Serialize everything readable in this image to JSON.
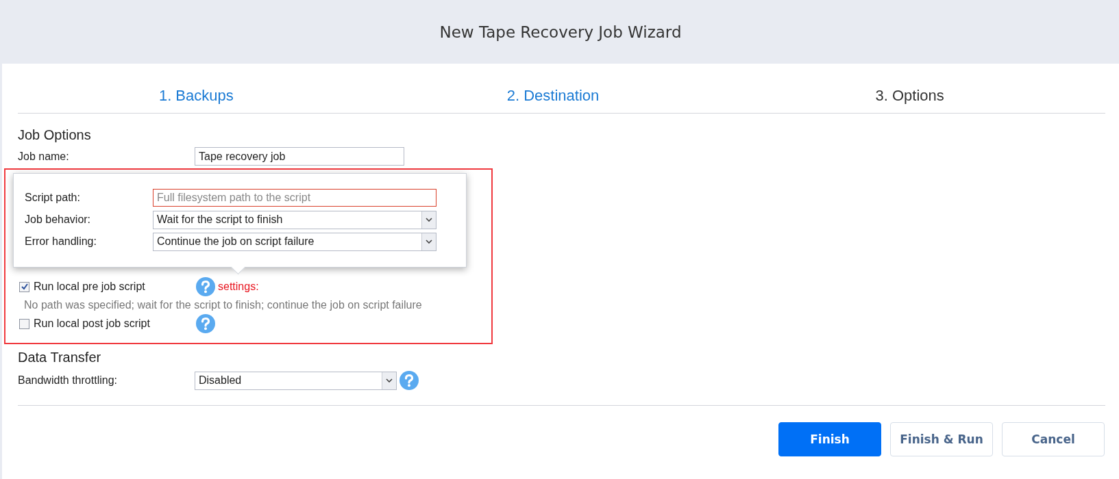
{
  "window": {
    "title": "New Tape Recovery Job Wizard"
  },
  "steps": [
    {
      "label": "1. Backups",
      "selected": false
    },
    {
      "label": "2. Destination",
      "selected": false
    },
    {
      "label": "3. Options",
      "selected": true
    }
  ],
  "job_options": {
    "heading": "Job Options",
    "job_name": {
      "label": "Job name:",
      "value": "Tape recovery job"
    },
    "pre_job_script": {
      "label": "Run local pre job script",
      "checked": true,
      "settings_link": "settings:",
      "summary": "No path was specified; wait for the script to finish; continue the job on script failure"
    },
    "post_job_script": {
      "label": "Run local post job script",
      "checked": false
    }
  },
  "script_popup": {
    "fields": [
      {
        "kind": "text",
        "label": "Script path:",
        "placeholder": "Full filesystem path to the script",
        "invalid": true
      },
      {
        "kind": "select",
        "label": "Job behavior:",
        "value": "Wait for the script to finish"
      },
      {
        "kind": "select",
        "label": "Error handling:",
        "value": "Continue the job on script failure"
      }
    ]
  },
  "data_transfer": {
    "heading": "Data Transfer",
    "bandwidth": {
      "label": "Bandwidth throttling:",
      "value": "Disabled"
    }
  },
  "buttons": [
    {
      "label": "Finish",
      "kind": "primary"
    },
    {
      "label": "Finish & Run",
      "kind": "secondary"
    },
    {
      "label": "Cancel",
      "kind": "secondary"
    }
  ]
}
